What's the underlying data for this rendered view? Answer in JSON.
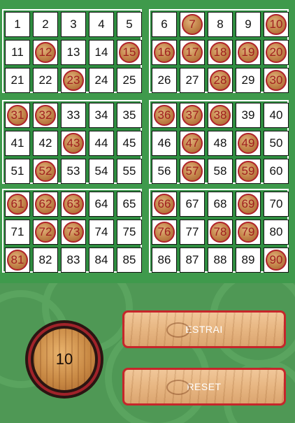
{
  "cards": [
    [
      [
        1,
        2,
        3,
        4,
        5
      ],
      [
        11,
        12,
        13,
        14,
        15
      ],
      [
        21,
        22,
        23,
        24,
        25
      ]
    ],
    [
      [
        6,
        7,
        8,
        9,
        10
      ],
      [
        16,
        17,
        18,
        19,
        20
      ],
      [
        26,
        27,
        28,
        29,
        30
      ]
    ],
    [
      [
        31,
        32,
        33,
        34,
        35
      ],
      [
        41,
        42,
        43,
        44,
        45
      ],
      [
        51,
        52,
        53,
        54,
        55
      ]
    ],
    [
      [
        36,
        37,
        38,
        39,
        40
      ],
      [
        46,
        47,
        48,
        49,
        50
      ],
      [
        56,
        57,
        58,
        59,
        60
      ]
    ],
    [
      [
        61,
        62,
        63,
        64,
        65
      ],
      [
        71,
        72,
        73,
        74,
        75
      ],
      [
        81,
        82,
        83,
        84,
        85
      ]
    ],
    [
      [
        66,
        67,
        68,
        69,
        70
      ],
      [
        76,
        77,
        78,
        79,
        80
      ],
      [
        86,
        87,
        88,
        89,
        90
      ]
    ]
  ],
  "drawn": [
    7,
    10,
    12,
    15,
    16,
    17,
    18,
    19,
    20,
    23,
    28,
    30,
    31,
    32,
    36,
    37,
    38,
    43,
    47,
    49,
    52,
    57,
    59,
    61,
    62,
    63,
    66,
    69,
    72,
    73,
    76,
    78,
    79,
    81,
    90
  ],
  "current_number": "10",
  "buttons": {
    "draw_label": "ESTRAI",
    "reset_label": "RESET"
  },
  "colors": {
    "board_green": "#3f9a4c",
    "drawn_border": "#b0222a",
    "button_border": "#c6262b"
  }
}
